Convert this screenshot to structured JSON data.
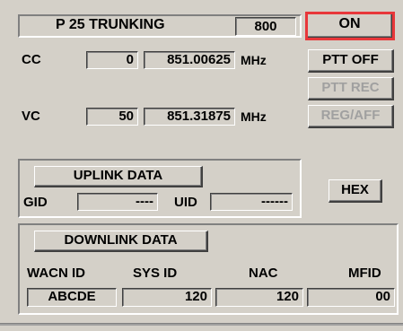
{
  "header": {
    "title": "P 25 TRUNKING",
    "band": "800",
    "power": "ON",
    "power_highlight": "#e8373a"
  },
  "cc": {
    "label": "CC",
    "channel": "0",
    "frequency": "851.00625",
    "unit": "MHz"
  },
  "vc": {
    "label": "VC",
    "channel": "50",
    "frequency": "851.31875",
    "unit": "MHz"
  },
  "buttons": {
    "ptt_off": "PTT OFF",
    "ptt_rec": "PTT REC",
    "reg_aff": "REG/AFF",
    "hex": "HEX"
  },
  "uplink": {
    "title": "UPLINK DATA",
    "gid_label": "GID",
    "gid_value": "----",
    "uid_label": "UID",
    "uid_value": "------"
  },
  "downlink": {
    "title": "DOWNLINK DATA",
    "wacn_label": "WACN ID",
    "sysid_label": "SYS ID",
    "nac_label": "NAC",
    "mfid_label": "MFID",
    "wacn_value": "ABCDE",
    "sysid_value": "120",
    "nac_value": "120",
    "mfid_value": "00"
  }
}
